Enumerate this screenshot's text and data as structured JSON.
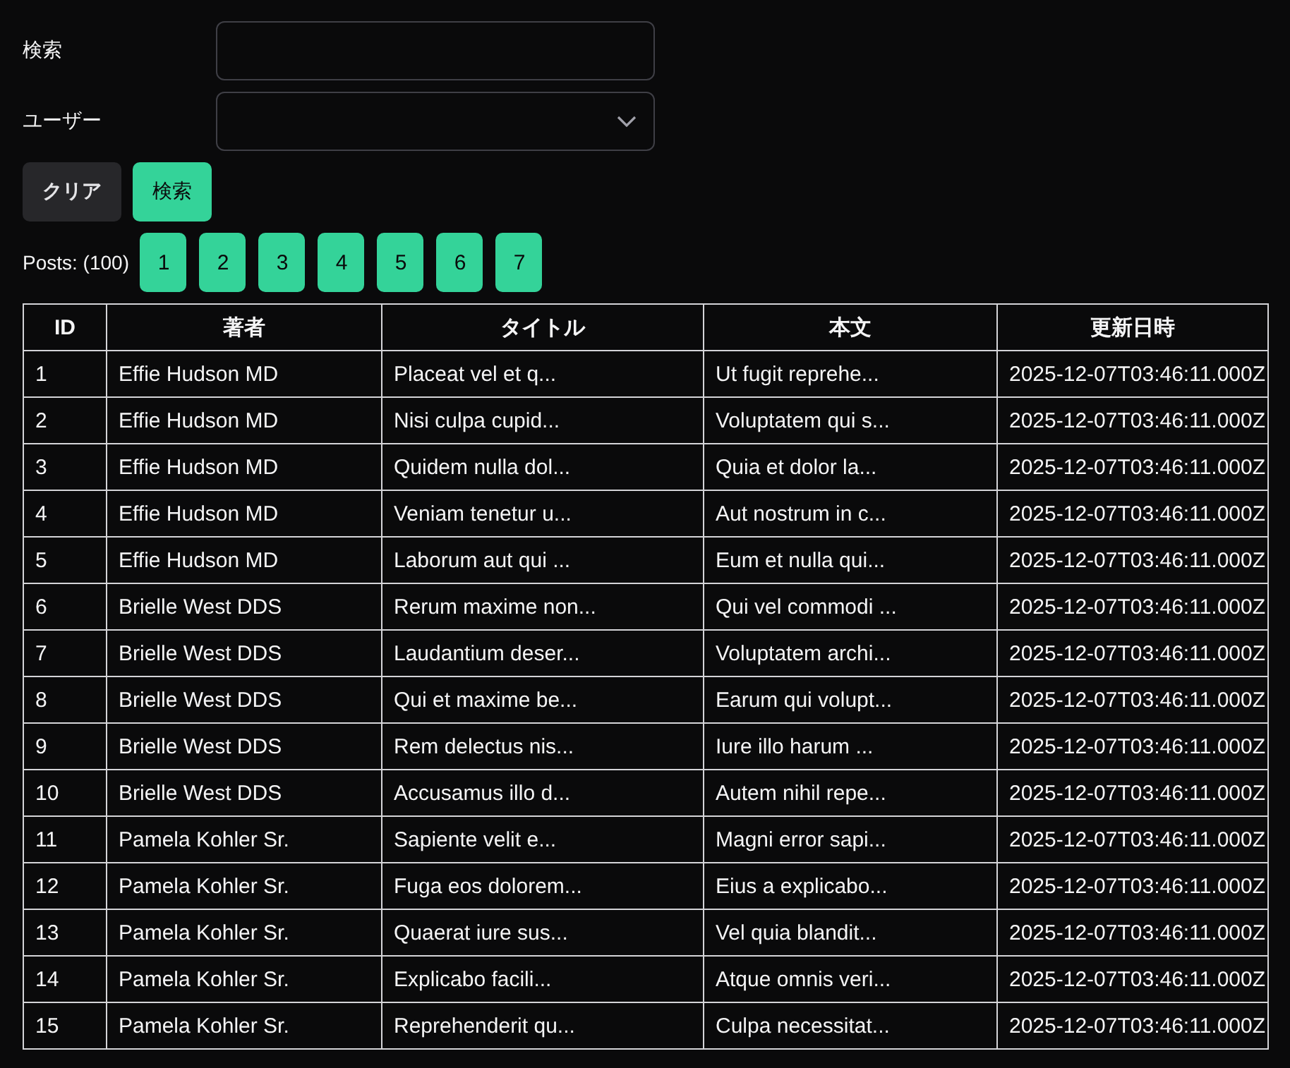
{
  "search_form": {
    "fields": [
      {
        "kind": "text",
        "label": "検索"
      },
      {
        "kind": "select",
        "label": "ユーザー"
      }
    ],
    "buttons": [
      {
        "kind": "secondary",
        "label": "クリア"
      },
      {
        "kind": "primary",
        "label": "検索"
      }
    ]
  },
  "pagination": {
    "count_label": "Posts: (100)",
    "pages": [
      "1",
      "2",
      "3",
      "4",
      "5",
      "6",
      "7"
    ]
  },
  "table": {
    "columns": [
      "ID",
      "著者",
      "タイトル",
      "本文",
      "更新日時"
    ],
    "rows": [
      [
        "1",
        "Effie Hudson MD",
        "Placeat vel et q...",
        "Ut fugit reprehe...",
        "2025-12-07T03:46:11.000Z"
      ],
      [
        "2",
        "Effie Hudson MD",
        "Nisi culpa cupid...",
        "Voluptatem qui s...",
        "2025-12-07T03:46:11.000Z"
      ],
      [
        "3",
        "Effie Hudson MD",
        "Quidem nulla dol...",
        "Quia et dolor la...",
        "2025-12-07T03:46:11.000Z"
      ],
      [
        "4",
        "Effie Hudson MD",
        "Veniam tenetur u...",
        "Aut nostrum in c...",
        "2025-12-07T03:46:11.000Z"
      ],
      [
        "5",
        "Effie Hudson MD",
        "Laborum aut qui ...",
        "Eum et nulla qui...",
        "2025-12-07T03:46:11.000Z"
      ],
      [
        "6",
        "Brielle West DDS",
        "Rerum maxime non...",
        "Qui vel commodi ...",
        "2025-12-07T03:46:11.000Z"
      ],
      [
        "7",
        "Brielle West DDS",
        "Laudantium deser...",
        "Voluptatem archi...",
        "2025-12-07T03:46:11.000Z"
      ],
      [
        "8",
        "Brielle West DDS",
        "Qui et maxime be...",
        "Earum qui volupt...",
        "2025-12-07T03:46:11.000Z"
      ],
      [
        "9",
        "Brielle West DDS",
        "Rem delectus nis...",
        "Iure illo harum ...",
        "2025-12-07T03:46:11.000Z"
      ],
      [
        "10",
        "Brielle West DDS",
        "Accusamus illo d...",
        "Autem nihil repe...",
        "2025-12-07T03:46:11.000Z"
      ],
      [
        "11",
        "Pamela Kohler Sr.",
        "Sapiente velit e...",
        "Magni error sapi...",
        "2025-12-07T03:46:11.000Z"
      ],
      [
        "12",
        "Pamela Kohler Sr.",
        "Fuga eos dolorem...",
        "Eius a explicabo...",
        "2025-12-07T03:46:11.000Z"
      ],
      [
        "13",
        "Pamela Kohler Sr.",
        "Quaerat iure sus...",
        "Vel quia blandit...",
        "2025-12-07T03:46:11.000Z"
      ],
      [
        "14",
        "Pamela Kohler Sr.",
        "Explicabo facili...",
        "Atque omnis veri...",
        "2025-12-07T03:46:11.000Z"
      ],
      [
        "15",
        "Pamela Kohler Sr.",
        "Reprehenderit qu...",
        "Culpa necessitat...",
        "2025-12-07T03:46:11.000Z"
      ]
    ]
  }
}
